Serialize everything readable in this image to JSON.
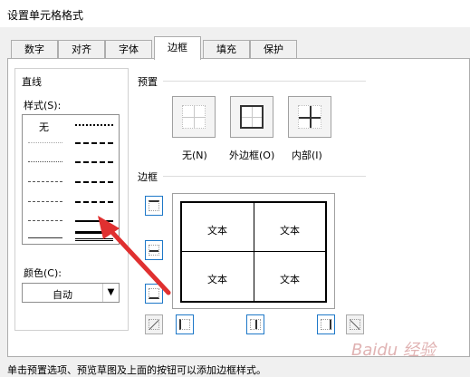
{
  "dialog": {
    "title": "设置单元格格式"
  },
  "tabs": [
    {
      "label": "数字"
    },
    {
      "label": "对齐"
    },
    {
      "label": "字体"
    },
    {
      "label": "边框"
    },
    {
      "label": "填充"
    },
    {
      "label": "保护"
    }
  ],
  "line": {
    "group_label": "直线",
    "style_label": "样式(S):",
    "none_label": "无",
    "color_label": "颜色(C):",
    "color_value": "自动"
  },
  "presets": {
    "label": "预置",
    "items": [
      {
        "label": "无(N)"
      },
      {
        "label": "外边框(O)"
      },
      {
        "label": "内部(I)"
      }
    ]
  },
  "border": {
    "label": "边框",
    "cells": [
      "文本",
      "文本",
      "文本",
      "文本"
    ]
  },
  "footer": "单击预置选项、预览草图及上面的按钮可以添加边框样式。",
  "watermark": "Baidu 经验",
  "colors": {
    "annotation_arrow": "#e03030",
    "button_border": "#1e78c8"
  }
}
